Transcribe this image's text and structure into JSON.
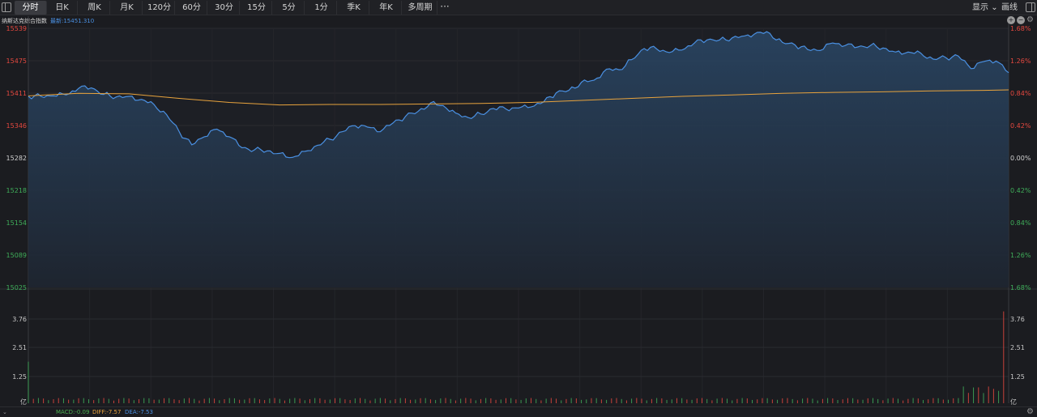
{
  "toolbar": {
    "tabs": [
      "分时",
      "日K",
      "周K",
      "月K",
      "120分",
      "60分",
      "30分",
      "15分",
      "5分",
      "1分",
      "季K",
      "年K",
      "多周期"
    ],
    "active_tab": "分时",
    "more_label": "···",
    "display_label": "显示",
    "draw_label": "画线"
  },
  "info": {
    "name": "纳斯达克综合指数",
    "latest": "最新:15451.310"
  },
  "footer": {
    "macd": "MACD:-0.09",
    "diff": "DIFF:-7.57",
    "dea": "DEA:-7.53"
  },
  "colors": {
    "background": "#1b1c20",
    "price_line": "#4a90e2",
    "avg_line": "#e8a33d",
    "up": "#e5483f",
    "down": "#3fae5a",
    "grid": "#2a2b30"
  },
  "chart_data": {
    "type": "line",
    "title": "纳斯达克综合指数",
    "price_axis": {
      "ticks": [
        "15539",
        "15475",
        "15411",
        "15346",
        "15282",
        "15218",
        "15154",
        "15089",
        "15025"
      ],
      "ylim": [
        15025,
        15539
      ],
      "base": 15282
    },
    "percent_axis": {
      "ticks": [
        "1.68%",
        "1.26%",
        "0.84%",
        "0.42%",
        "0.00%",
        "0.42%",
        "0.84%",
        "1.26%",
        "1.68%"
      ]
    },
    "volume_axis": {
      "ticks": [
        "3.76",
        "2.51",
        "1.25",
        "亿"
      ],
      "ylim": [
        0,
        5
      ]
    },
    "series": [
      {
        "name": "price",
        "x": [
          0,
          5,
          10,
          15,
          20,
          25,
          30,
          35,
          40,
          45,
          50,
          55,
          60,
          65,
          70,
          75,
          80,
          85,
          90,
          95,
          100,
          105,
          110,
          115,
          120,
          125,
          130,
          135,
          140,
          145,
          150,
          155,
          160,
          165,
          170,
          175,
          180,
          185,
          190,
          195,
          200,
          205,
          210,
          215,
          220,
          225,
          230,
          235,
          240,
          245,
          250,
          255,
          260,
          265,
          270,
          275,
          280,
          285,
          290,
          295,
          300,
          305,
          310,
          315,
          320,
          325,
          330,
          335,
          340,
          345,
          350,
          355,
          360,
          365,
          370,
          375,
          380,
          385,
          390
        ],
        "values": [
          15404,
          15404,
          15405,
          15407,
          15420,
          15421,
          15408,
          15403,
          15404,
          15398,
          15388,
          15368,
          15334,
          15308,
          15324,
          15339,
          15324,
          15302,
          15298,
          15296,
          15291,
          15283,
          15295,
          15307,
          15319,
          15334,
          15346,
          15343,
          15334,
          15351,
          15364,
          15374,
          15391,
          15386,
          15371,
          15362,
          15369,
          15380,
          15379,
          15381,
          15383,
          15393,
          15411,
          15416,
          15432,
          15436,
          15458,
          15457,
          15477,
          15499,
          15498,
          15491,
          15496,
          15510,
          15516,
          15516,
          15520,
          15524,
          15531,
          15529,
          15511,
          15506,
          15497,
          15495,
          15510,
          15505,
          15502,
          15505,
          15500,
          15492,
          15492,
          15490,
          15478,
          15481,
          15484,
          15459,
          15473,
          15474,
          15451
        ]
      },
      {
        "name": "average",
        "x": [
          0,
          20,
          40,
          60,
          80,
          100,
          120,
          140,
          160,
          180,
          200,
          220,
          240,
          260,
          280,
          300,
          320,
          340,
          360,
          380,
          390
        ],
        "values": [
          15405,
          15410,
          15409,
          15400,
          15392,
          15387,
          15388,
          15388,
          15389,
          15390,
          15392,
          15396,
          15400,
          15404,
          15407,
          15410,
          15412,
          15413,
          15415,
          15416,
          15417
        ]
      }
    ],
    "volume": {
      "x_count": 390,
      "first_bar": 1.9,
      "last_bar": 4.2,
      "typical": 0.2,
      "closing_cluster": 0.6
    }
  }
}
